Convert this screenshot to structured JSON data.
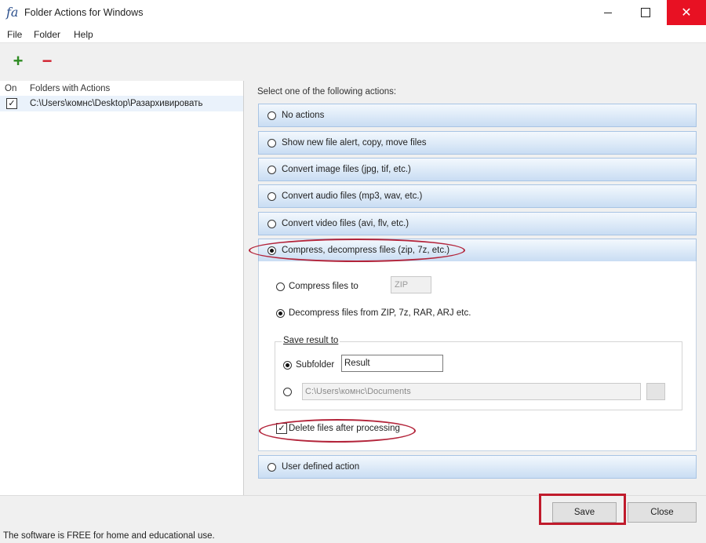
{
  "window": {
    "icon_text": "fa",
    "title": "Folder Actions for Windows",
    "minimize_glyph": "",
    "maximize_glyph": "",
    "close_glyph": "✕"
  },
  "menu": {
    "items": [
      "File",
      "Folder",
      "Help"
    ]
  },
  "toolbar": {
    "add_glyph": "+",
    "remove_glyph": "−"
  },
  "folders_list": {
    "col_on": "On",
    "col_folders": "Folders with Actions",
    "rows": [
      {
        "checked": true,
        "check_glyph": "✓",
        "path": "C:\\Users\\комнс\\Desktop\\Разархивировать"
      }
    ]
  },
  "actions": {
    "prompt": "Select one of the following actions:",
    "options": [
      {
        "label": "No actions",
        "selected": false
      },
      {
        "label": "Show new file alert, copy, move files",
        "selected": false
      },
      {
        "label": "Convert image files (jpg, tif, etc.)",
        "selected": false
      },
      {
        "label": "Convert audio files (mp3, wav, etc.)",
        "selected": false
      },
      {
        "label": "Convert video files (avi, flv, etc.)",
        "selected": false
      },
      {
        "label": "Compress, decompress files (zip, 7z, etc.)",
        "selected": true
      },
      {
        "label": "User defined action",
        "selected": false
      }
    ]
  },
  "compress": {
    "compress_label": "Compress files to",
    "compress_selected": false,
    "format_value": "ZIP",
    "decompress_label": "Decompress files from  ZIP, 7z, RAR, ARJ etc.",
    "decompress_selected": true,
    "save_group_label": "Save result to",
    "subfolder_label": "Subfolder",
    "subfolder_selected": true,
    "subfolder_value": "Result",
    "custom_path_selected": false,
    "custom_path_value": "C:\\Users\\комнс\\Documents",
    "delete_label": "Delete files after processing",
    "delete_checked": true,
    "delete_check_glyph": "✓"
  },
  "buttons": {
    "save": "Save",
    "close": "Close"
  },
  "status": {
    "text": "The software is FREE for home and educational use."
  },
  "colors": {
    "annotation_red": "#b3243a",
    "close_button_red": "#e81123",
    "add_green": "#2e8b22",
    "remove_red": "#d1202e",
    "option_bar_gradient_bottom": "#c9ddf3"
  }
}
